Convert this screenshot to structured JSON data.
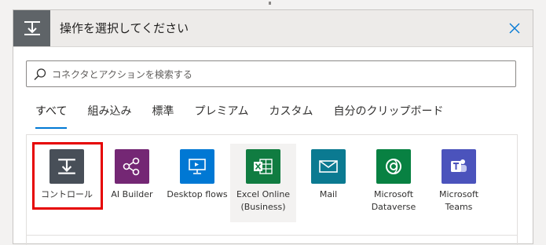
{
  "header": {
    "title": "操作を選択してください"
  },
  "search": {
    "placeholder": "コネクタとアクションを検索する"
  },
  "tabs": [
    {
      "label": "すべて",
      "active": true
    },
    {
      "label": "組み込み"
    },
    {
      "label": "標準"
    },
    {
      "label": "プレミアム"
    },
    {
      "label": "カスタム"
    },
    {
      "label": "自分のクリップボード"
    }
  ],
  "connectors": [
    {
      "label": "コントロール",
      "color": "#484f58",
      "icon": "control-icon"
    },
    {
      "label": "AI Builder",
      "color": "#742774",
      "icon": "ai-builder-icon"
    },
    {
      "label": "Desktop flows",
      "color": "#0078d4",
      "icon": "desktop-flows-icon"
    },
    {
      "label": "Excel Online (Business)",
      "color": "#107c41",
      "icon": "excel-icon"
    },
    {
      "label": "Mail",
      "color": "#0b7a91",
      "icon": "mail-icon"
    },
    {
      "label": "Microsoft Dataverse",
      "color": "#088142",
      "icon": "dataverse-icon"
    },
    {
      "label": "Microsoft Teams",
      "color": "#4b53bc",
      "icon": "teams-icon"
    }
  ],
  "colors": {
    "accent": "#0078d4",
    "highlight": "#e60000",
    "header_icon_bg": "#5f6468"
  }
}
